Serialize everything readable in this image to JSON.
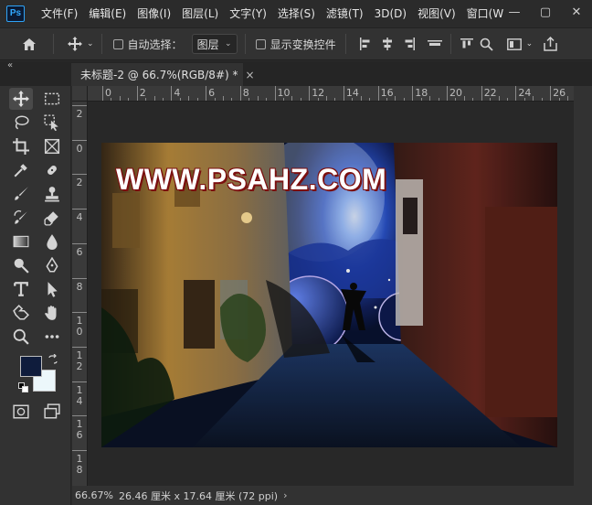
{
  "app": {
    "logo": "Ps"
  },
  "menu": {
    "items": [
      "文件(F)",
      "编辑(E)",
      "图像(I)",
      "图层(L)",
      "文字(Y)",
      "选择(S)",
      "滤镜(T)",
      "3D(D)",
      "视图(V)",
      "窗口(W"
    ]
  },
  "window_controls": {
    "minimize": "—",
    "maximize": "▢",
    "close": "✕"
  },
  "options": {
    "auto_select_label": "自动选择：",
    "layer_select_value": "图层",
    "show_transform_label": "显示变换控件"
  },
  "tab": {
    "title": "未标题-2 @ 66.7%(RGB/8#) *",
    "close": "×",
    "collapse": "«"
  },
  "ruler": {
    "h_labels": [
      "0",
      "2",
      "4",
      "6",
      "8",
      "10",
      "12",
      "14",
      "16",
      "18",
      "20",
      "22",
      "24",
      "26"
    ],
    "v_labels": [
      "2",
      "0",
      "2",
      "4",
      "6",
      "8",
      "1 0",
      "1 2",
      "1 4",
      "1 6",
      "1 8"
    ]
  },
  "canvas": {
    "watermark": "WWW.PSAHZ.COM"
  },
  "colors": {
    "foreground": "#0f1c3c",
    "background": "#ecf7fb",
    "watermark_outline": "#7b0f0f"
  },
  "status": {
    "zoom": "66.67%",
    "doc_info": "26.46 厘米 x 17.64 厘米 (72 ppi)",
    "arrow": "›"
  },
  "icons": {
    "toolbar": [
      "move-icon",
      "marquee-icon",
      "lasso-icon",
      "object-select-icon",
      "crop-icon",
      "frame-icon",
      "eyedropper-icon",
      "healing-brush-icon",
      "brush-icon",
      "stamp-icon",
      "history-brush-icon",
      "eraser-icon",
      "gradient-icon",
      "blur-icon",
      "dodge-icon",
      "pen-icon",
      "type-icon",
      "path-select-icon",
      "shape-icon",
      "hand-icon",
      "zoom-icon",
      "more-icon",
      "quick-mask-icon",
      "screen-mode-icon"
    ]
  }
}
